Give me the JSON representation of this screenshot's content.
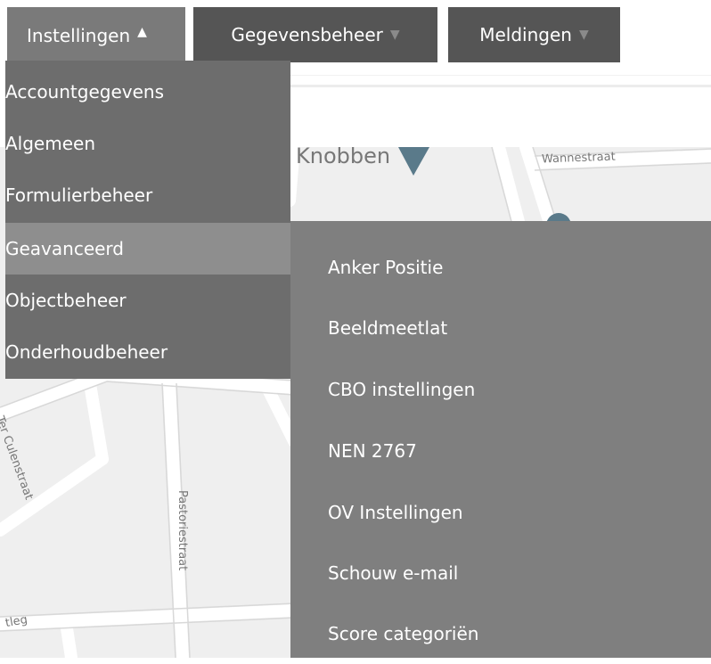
{
  "nav": {
    "tabs": [
      {
        "label": "Instellingen",
        "caret": "▲"
      },
      {
        "label": "Gegevensbeheer",
        "caret": "▼"
      },
      {
        "label": "Meldingen",
        "caret": "▼"
      }
    ]
  },
  "dropdown": {
    "items": [
      {
        "label": "Accountgegevens"
      },
      {
        "label": "Algemeen"
      },
      {
        "label": "Formulierbeheer"
      },
      {
        "label": "Geavanceerd"
      },
      {
        "label": "Objectbeheer"
      },
      {
        "label": "Onderhoudbeheer"
      }
    ]
  },
  "submenu": {
    "items": [
      {
        "label": "Anker Positie"
      },
      {
        "label": "Beeldmeetlat"
      },
      {
        "label": "CBO instellingen"
      },
      {
        "label": "NEN 2767"
      },
      {
        "label": "OV Instellingen"
      },
      {
        "label": "Schouw e-mail"
      },
      {
        "label": "Score categoriën"
      }
    ]
  },
  "map": {
    "labels": {
      "knobben": "Knobben",
      "wannestraat": "Wannestraat",
      "culenstraat": "Ter Culenstraat",
      "pastoriestraat": "Pastoriestraat",
      "tleg": "tleg"
    },
    "marker_icon": "map-marker-icon"
  },
  "colors": {
    "active_tab": "#7a7a7a",
    "inactive_tab": "#555555",
    "dropdown_bg": "#6d6d6d",
    "dropdown_active": "#8e8e8e",
    "submenu_bg": "#7f7f7f"
  }
}
